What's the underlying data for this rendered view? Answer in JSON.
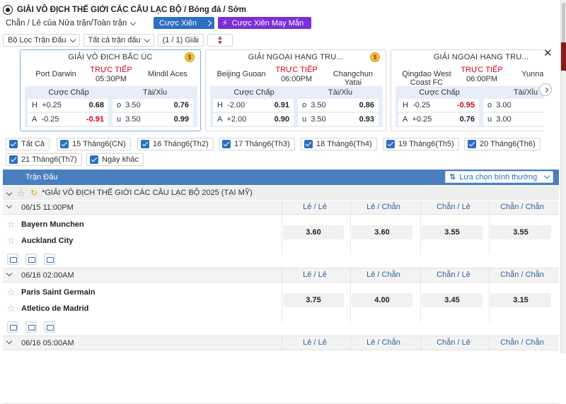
{
  "header": {
    "title": "GIẢI VÔ ĐỊCH THẾ GIỚI CÁC CÂU LẠC BỘ / Bóng đá / Sớm"
  },
  "controls": {
    "odds_type": "Chẵn / Lẻ của Nửa trận/Toàn trận",
    "cuoc_xien": "Cược Xiên",
    "cuoc_xien_may_man": "Cược Xiên May Mắn",
    "filter_label": "Bộ Lọc Trận Đấu",
    "all_matches": "Tất cả trận đấu",
    "league_count": "(1 / 1) Giải"
  },
  "colors": {
    "accent_blue": "#2d6fc1",
    "purple": "#7b2fd8",
    "live_red": "#d0021b",
    "header_bar": "#4a7fbe"
  },
  "cards": [
    {
      "league": "GIẢI VÔ ĐỊCH BẮC ÚC",
      "home": "Port Darwin",
      "away": "Mindil Aces",
      "status": "TRỰC TIẾP",
      "time": "05:30PM",
      "handicap_label": "Cược Chấp",
      "ou_label": "Tài/Xỉu",
      "h_line": "+0.25",
      "h_odds": "0.68",
      "a_line": "-0.25",
      "a_odds": "-0.91",
      "o_line": "3.50",
      "o_odds": "0.76",
      "u_line": "3.50",
      "u_odds": "0.99"
    },
    {
      "league": "GIẢI NGOẠI HẠNG TRU...",
      "home": "Beijing Guoan",
      "away": "Changchun Yatai",
      "status": "TRỰC TIẾP",
      "time": "06:00PM",
      "handicap_label": "Cược Chấp",
      "ou_label": "Tài/Xỉu",
      "h_line": "-2.00",
      "h_odds": "0.91",
      "a_line": "+2.00",
      "a_odds": "0.90",
      "o_line": "3.50",
      "o_odds": "0.86",
      "u_line": "3.50",
      "u_odds": "0.93"
    },
    {
      "league": "GIẢI NGOẠI HẠNG TRU...",
      "home": "Qingdao West Coast FC",
      "away": "Yunnan Y",
      "status": "TRỰC TIẾP",
      "time": "06:00PM",
      "handicap_label": "Cược Chấp",
      "ou_label": "Tài/Xỉu",
      "h_line": "-0.25",
      "h_odds": "-0.95",
      "a_line": "+0.25",
      "a_odds": "0.76",
      "o_line": "3.00",
      "o_odds": "",
      "u_line": "3.00",
      "u_odds": ""
    }
  ],
  "date_filters": [
    "Tất Cả",
    "15 Tháng6(CN)",
    "16 Tháng6(Th2)",
    "17 Tháng6(Th3)",
    "18 Tháng6(Th4)",
    "19 Tháng6(Th5)",
    "20 Tháng6(Th6)",
    "21 Tháng6(Th7)",
    "Ngày khác"
  ],
  "table": {
    "header": "Trận Đấu",
    "sort": "Lựa chọn bình thường",
    "league": "*GIẢI VÔ ĐỊCH THẾ GIỚI CÁC CÂU LẠC BỘ 2025 (TẠI MỸ)",
    "columns": [
      "Lẻ / Lẻ",
      "Lẻ / Chẵn",
      "Chẵn / Lẻ",
      "Chẵn / Chẵn"
    ],
    "matches": [
      {
        "time": "06/15 11:00PM",
        "home": "Bayern Munchen",
        "away": "Auckland City",
        "odds": [
          "3.60",
          "3.60",
          "3.55",
          "3.55"
        ]
      },
      {
        "time": "06/16 02:00AM",
        "home": "Paris Saint Germain",
        "away": "Atletico de Madrid",
        "odds": [
          "3.75",
          "4.00",
          "3.45",
          "3.15"
        ]
      },
      {
        "time": "06/16 05:00AM"
      }
    ]
  }
}
